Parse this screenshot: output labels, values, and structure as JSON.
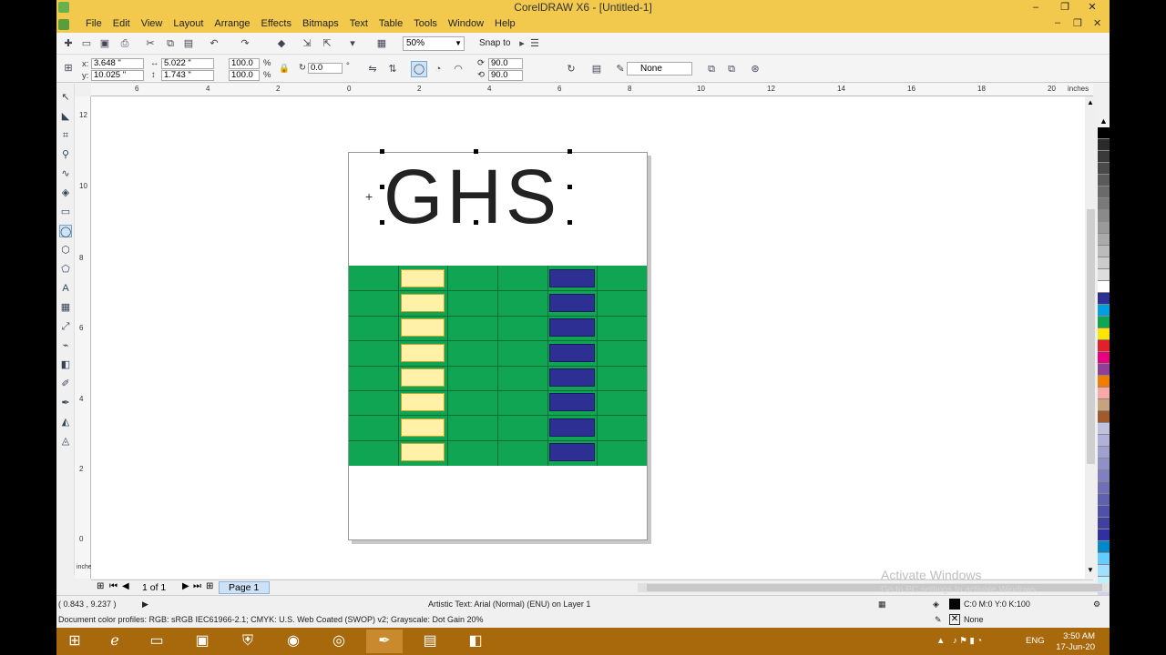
{
  "window": {
    "title": "CorelDRAW X6 - [Untitled-1]",
    "controls": [
      "–",
      "❐",
      "✕"
    ]
  },
  "menu": {
    "items": [
      "File",
      "Edit",
      "View",
      "Layout",
      "Arrange",
      "Effects",
      "Bitmaps",
      "Text",
      "Table",
      "Tools",
      "Window",
      "Help"
    ],
    "doc_controls": [
      "–",
      "❐",
      "✕"
    ]
  },
  "toolbar": {
    "zoom": "50%",
    "snap_label": "Snap to"
  },
  "propertybar": {
    "x_label": "x:",
    "x_value": "3.648 \"",
    "y_label": "y:",
    "y_value": "10.025 \"",
    "w_value": "5.022 \"",
    "h_value": "1.743 \"",
    "scale_w": "100.0",
    "scale_h": "100.0",
    "pct": "%",
    "rotation": "0.0",
    "deg": "°",
    "angle1": "90.0",
    "angle2": "90.0",
    "outline": "None"
  },
  "hruler": {
    "ticks": [
      "6",
      "4",
      "2",
      "0",
      "2",
      "4",
      "6",
      "8",
      "10",
      "12",
      "14",
      "16",
      "18",
      "20"
    ],
    "unit": "inches"
  },
  "vruler": {
    "ticks": [
      "12",
      "10",
      "8",
      "6",
      "4",
      "2",
      "0"
    ],
    "unit": "inches"
  },
  "canvas": {
    "text": "GHS",
    "grid": {
      "rows": 8,
      "cols": 6,
      "bg_color": "#10a552",
      "yellow_color": "#fff2a8",
      "blue_color": "#2e2f93"
    }
  },
  "pagenav": {
    "page_count": "1 of 1",
    "page_tab": "Page 1"
  },
  "status": {
    "coords": "( 0.843 , 9.237 )",
    "object_info": "Artistic Text: Arial (Normal) (ENU) on Layer 1",
    "profiles": "Document color profiles: RGB: sRGB IEC61966-2.1; CMYK: U.S. Web Coated (SWOP) v2; Grayscale: Dot Gain 20%",
    "fill": "C:0 M:0 Y:0 K:100",
    "outline": "None"
  },
  "watermark": {
    "line1": "Activate Windows",
    "line2": "Go to PC settings to activate Windows."
  },
  "palette": [
    "#000000",
    "#2b2b2b",
    "#3a3a3a",
    "#4a4a4a",
    "#5a5a5a",
    "#6a6a6a",
    "#7a7a7a",
    "#8a8a8a",
    "#9a9a9a",
    "#aaaaaa",
    "#bbbbbb",
    "#cccccc",
    "#dddddd",
    "#ffffff",
    "#2e2f93",
    "#00a0e0",
    "#10a552",
    "#ffe600",
    "#e0202a",
    "#e6007e",
    "#8f3f97",
    "#f07d00",
    "#f7a8a8",
    "#c8a27c",
    "#a05a2c",
    "#c0c0e0",
    "#b0b0d8",
    "#a0a0d0",
    "#9090c8",
    "#8080c0",
    "#7070b8",
    "#6060b0",
    "#5050a8",
    "#4040a0",
    "#3030a0",
    "#0088cc",
    "#66ccff",
    "#a0e0ff",
    "#c0f0ff",
    "#d0d0f0"
  ],
  "taskbar": {
    "lang": "ENG",
    "time": "3:50 AM",
    "date": "17-Jun-20"
  }
}
